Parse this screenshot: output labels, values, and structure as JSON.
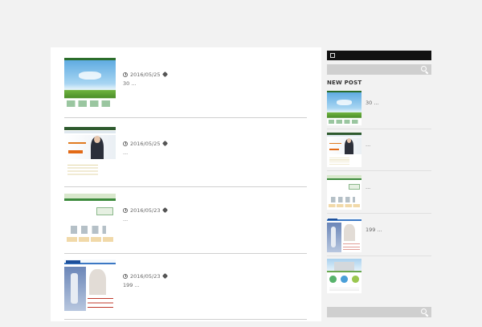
{
  "posts": [
    {
      "date": "2016/05/25",
      "excerpt": "30 ..."
    },
    {
      "date": "2016/05/25",
      "excerpt": "..."
    },
    {
      "date": "2016/05/23",
      "excerpt": "..."
    },
    {
      "date": "2016/05/23",
      "excerpt": "199 ..."
    }
  ],
  "sidebar": {
    "widget_title": "NEW POST",
    "rss_icon": "rss-icon",
    "search_icon": "search-icon",
    "new_posts": [
      {
        "excerpt": "30 ..."
      },
      {
        "excerpt": "..."
      },
      {
        "excerpt": "..."
      },
      {
        "excerpt": "199 ..."
      },
      {
        "excerpt": ""
      }
    ]
  },
  "icons": {
    "date": "clock-icon",
    "category": "tag-icon"
  },
  "colors": {
    "page_bg": "#f2f2f2",
    "content_bg": "#ffffff",
    "sidebar_header": "#111111",
    "search_bar": "#cfcfcf"
  }
}
